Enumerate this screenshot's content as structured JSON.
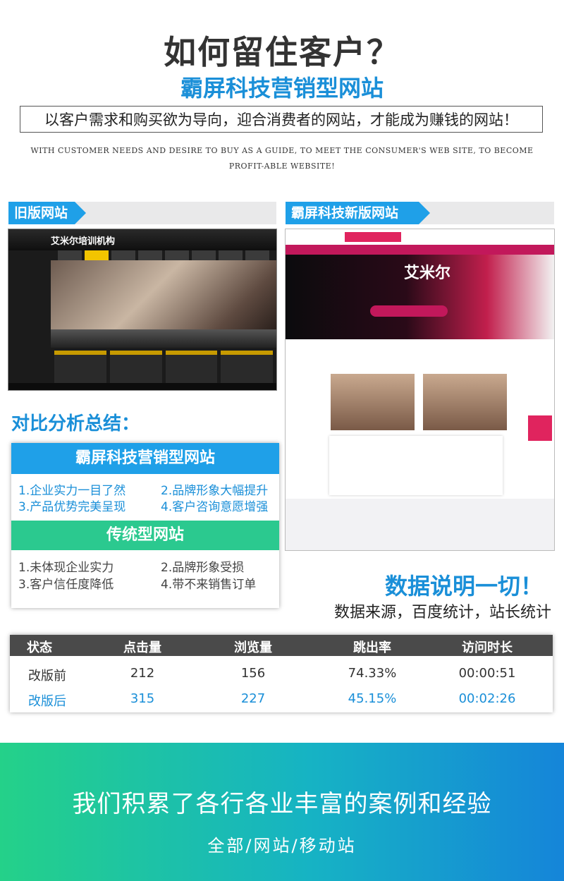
{
  "header": {
    "title": "如何留住客户？",
    "subtitle": "霸屏科技营销型网站",
    "slogan": "以客户需求和购买欲为导向，迎合消费者的网站，才能成为赚钱的网站！",
    "english": "WITH CUSTOMER NEEDS AND DESIRE TO BUY AS A GUIDE, TO MEET THE CONSUMER'S WEB SITE, TO BECOME PROFIT-ABLE WEBSITE!"
  },
  "old_section": {
    "label": "旧版网站",
    "screenshot_logo": "艾米尔培训机构"
  },
  "new_section": {
    "label": "霸屏科技新版网站",
    "screenshot_hero_title": "艾米尔"
  },
  "comparison": {
    "title": "对比分析总结：",
    "marketing_header": "霸屏科技营销型网站",
    "marketing_items": [
      "1.企业实力一目了然",
      "2.品牌形象大幅提升",
      "3.产品优势完美呈现",
      "4.客户咨询意愿增强"
    ],
    "traditional_header": "传统型网站",
    "traditional_items": [
      "1.未体现企业实力",
      "2.品牌形象受损",
      "3.客户信任度降低",
      "4.带不来销售订单"
    ]
  },
  "data_section": {
    "title": "数据说明一切！",
    "source": "数据来源，百度统计，站长统计"
  },
  "stats_table": {
    "columns": [
      "状态",
      "点击量",
      "浏览量",
      "跳出率",
      "访问时长"
    ],
    "rows": [
      [
        "改版前",
        "212",
        "156",
        "74.33%",
        "00:00:51"
      ],
      [
        "改版后",
        "315",
        "227",
        "45.15%",
        "00:02:26"
      ]
    ]
  },
  "banner": {
    "line1": "我们积累了各行各业丰富的案例和经验",
    "line2": "全部/网站/移动站"
  },
  "colors": {
    "accent_blue": "#1a8fd8",
    "ribbon_blue": "#1fa0e8",
    "accent_green": "#2bc98f"
  }
}
